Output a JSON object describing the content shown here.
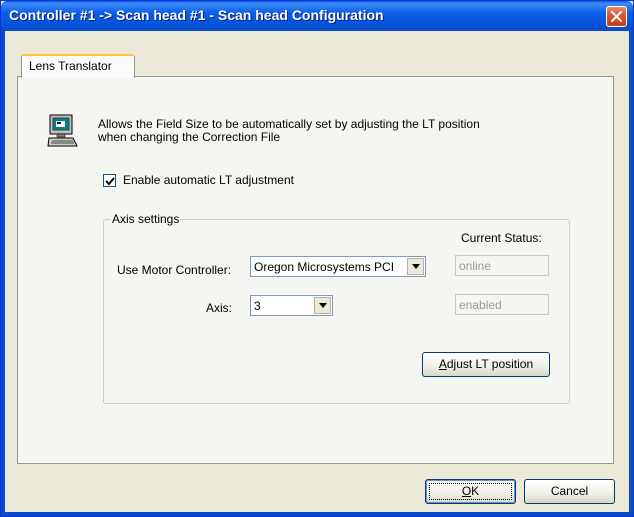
{
  "window": {
    "title": "Controller #1 -> Scan head #1 - Scan head Configuration",
    "close_icon": "close-icon"
  },
  "tabs": [
    {
      "label": "Lens Translator",
      "selected": true
    }
  ],
  "panel": {
    "icon": "computer-icon",
    "description_line1": "Allows the Field Size to be automatically set by adjusting the LT position",
    "description_line2": "when changing the Correction File",
    "enable_checkbox": {
      "label": "Enable automatic LT adjustment",
      "checked": true
    }
  },
  "axis_settings": {
    "legend": "Axis settings",
    "current_status_label": "Current Status:",
    "motor_controller_label": "Use Motor Controller:",
    "motor_controller_value": "Oregon Microsystems PCI",
    "motor_status": "online",
    "axis_label": "Axis:",
    "axis_value": "3",
    "axis_status": "enabled",
    "adjust_button": {
      "mnemonic": "A",
      "rest": "djust LT position"
    }
  },
  "footer": {
    "ok_button": {
      "mnemonic": "O",
      "rest": "K"
    },
    "cancel_button": "Cancel"
  },
  "colors": {
    "titlebar": "#0a5ae3",
    "dialog_bg": "#ece9d8",
    "panel_bg": "#f5f5f1",
    "tab_highlight": "#ffc83c",
    "close_button": "#d8512c"
  }
}
